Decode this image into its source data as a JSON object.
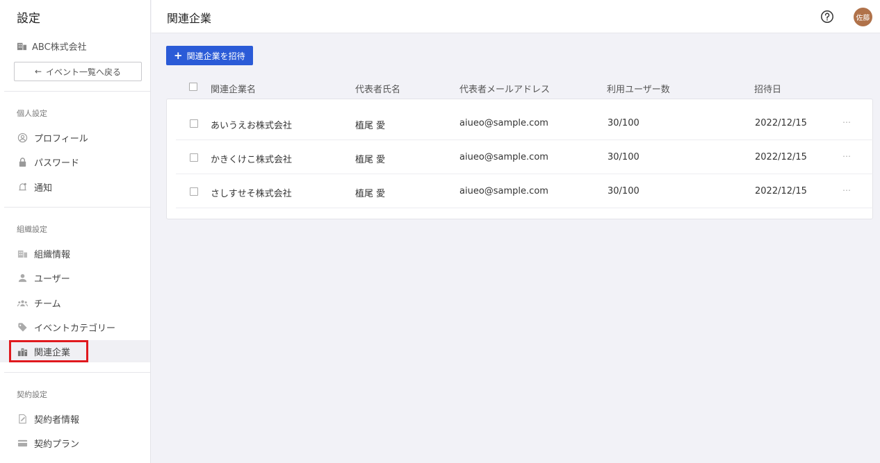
{
  "sidebar": {
    "title": "設定",
    "org_name": "ABC株式会社",
    "back_label": "イベント一覧へ戻る",
    "sections": {
      "personal": "個人設定",
      "org": "組織設定",
      "contract": "契約設定"
    },
    "items": {
      "profile": "プロフィール",
      "password": "パスワード",
      "notification": "通知",
      "org_info": "組織情報",
      "users": "ユーザー",
      "team": "チーム",
      "event_category": "イベントカテゴリー",
      "related_companies": "関連企業",
      "contractor_info": "契約者情報",
      "contract_plan": "契約プラン"
    }
  },
  "header": {
    "title": "関連企業",
    "avatar_text": "佐藤"
  },
  "main": {
    "invite_label": "関連企業を招待",
    "columns": {
      "company": "関連企業名",
      "rep_name": "代表者氏名",
      "rep_email": "代表者メールアドレス",
      "users": "利用ユーザー数",
      "invited": "招待日"
    },
    "rows": [
      {
        "company": "あいうえお株式会社",
        "rep_name": "植尾 愛",
        "email": "aiueo@sample.com",
        "users": "30/100",
        "date": "2022/12/15"
      },
      {
        "company": "かきくけこ株式会社",
        "rep_name": "植尾 愛",
        "email": "aiueo@sample.com",
        "users": "30/100",
        "date": "2022/12/15"
      },
      {
        "company": "さしすせそ株式会社",
        "rep_name": "植尾 愛",
        "email": "aiueo@sample.com",
        "users": "30/100",
        "date": "2022/12/15"
      }
    ]
  },
  "colors": {
    "accent": "#2b5bd7",
    "highlight": "#e0191e",
    "avatar": "#b0724a"
  }
}
